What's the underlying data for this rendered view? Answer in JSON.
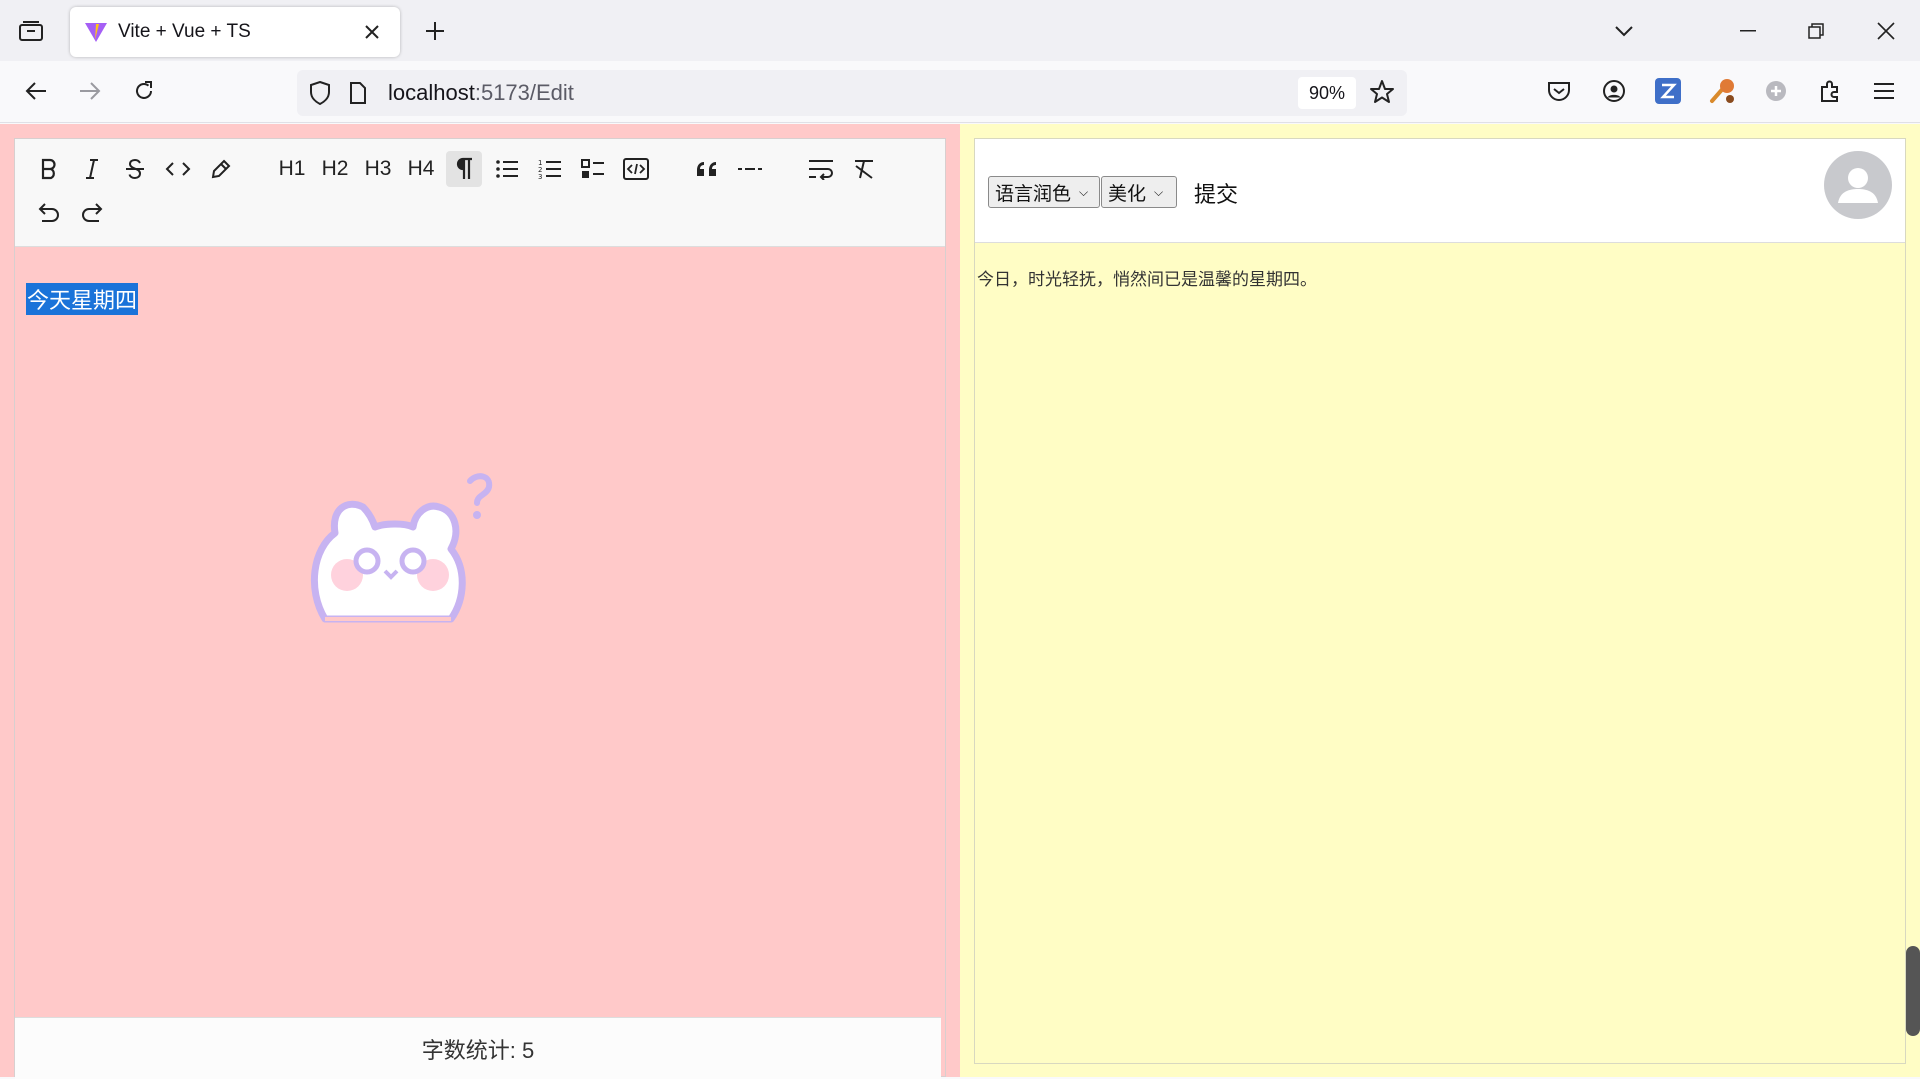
{
  "browser": {
    "tab_title": "Vite + Vue + TS",
    "url_host": "localhost",
    "url_rest": ":5173/Edit",
    "zoom": "90%"
  },
  "editor": {
    "content_text": "今天星期四",
    "word_count_label": "字数统计: 5",
    "toolbar": {
      "h1": "H1",
      "h2": "H2",
      "h3": "H3",
      "h4": "H4"
    }
  },
  "preview": {
    "select_polish": "语言润色",
    "select_beautify": "美化",
    "submit_label": "提交",
    "output_text": "今日，时光轻抚，悄然间已是温馨的星期四。"
  }
}
